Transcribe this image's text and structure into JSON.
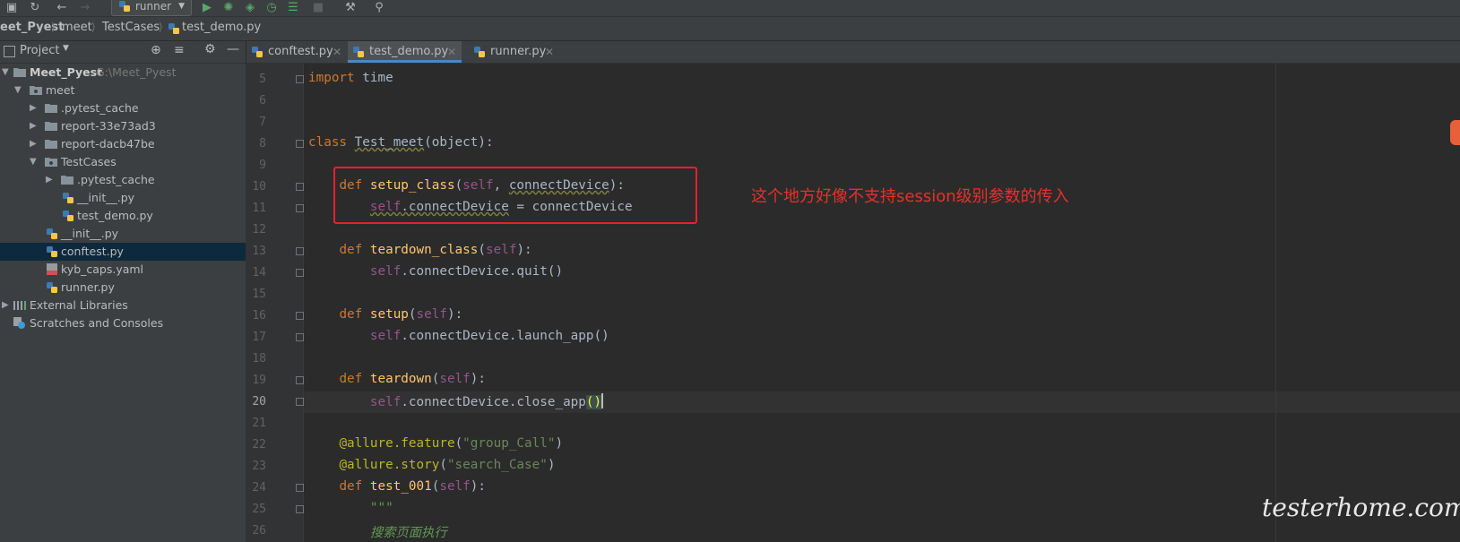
{
  "toolbar": {
    "run_config": "runner",
    "icons": [
      "save-icon",
      "sync-icon",
      "back-arrow-icon",
      "forward-arrow-icon",
      "run-icon",
      "debug-icon",
      "coverage-icon",
      "profile-icon",
      "run-tasks-icon",
      "stop-icon",
      "wrench-icon",
      "search-icon"
    ]
  },
  "breadcrumb": [
    "eet_Pyest",
    "meet",
    "TestCases",
    "test_demo.py"
  ],
  "project_panel": {
    "title": "Project",
    "tree": [
      {
        "label": "Meet_Pyest",
        "path": "G:\\Meet_Pyest"
      },
      {
        "label": "meet"
      },
      {
        "label": ".pytest_cache"
      },
      {
        "label": "report-33e73ad3"
      },
      {
        "label": "report-dacb47be"
      },
      {
        "label": "TestCases"
      },
      {
        "label": ".pytest_cache"
      },
      {
        "label": "__init__.py"
      },
      {
        "label": "test_demo.py"
      },
      {
        "label": "__init__.py"
      },
      {
        "label": "conftest.py"
      },
      {
        "label": "kyb_caps.yaml"
      },
      {
        "label": "runner.py"
      },
      {
        "label": "External Libraries"
      },
      {
        "label": "Scratches and Consoles"
      }
    ]
  },
  "tabs": [
    {
      "label": "conftest.py"
    },
    {
      "label": "test_demo.py"
    },
    {
      "label": "runner.py"
    }
  ],
  "editor": {
    "line_numbers": [
      "5",
      "6",
      "7",
      "8",
      "9",
      "10",
      "11",
      "12",
      "13",
      "14",
      "15",
      "16",
      "17",
      "18",
      "19",
      "20",
      "21",
      "22",
      "23",
      "24",
      "25",
      "26"
    ],
    "lines": {
      "l5": {
        "kw": "import",
        "rest": " time"
      },
      "l8": {
        "kw": "class",
        "name": "Test_meet",
        "base": "(object):"
      },
      "l10": {
        "kw": "def",
        "fn": "setup_class",
        "open": "(",
        "self": "self",
        "args": ", ",
        "param": "connectDevice",
        "close": "):"
      },
      "l11": {
        "self": "self",
        "attr": ".connectDevice",
        "rest": " = connectDevice"
      },
      "l13": {
        "kw": "def",
        "fn": "teardown_class",
        "open": "(",
        "self": "self",
        "close": "):"
      },
      "l14": {
        "self": "self",
        "rest": ".connectDevice.quit()"
      },
      "l16": {
        "kw": "def",
        "fn": "setup",
        "open": "(",
        "self": "self",
        "close": "):"
      },
      "l17": {
        "self": "self",
        "rest": ".connectDevice.launch_app()"
      },
      "l19": {
        "kw": "def",
        "fn": "teardown",
        "open": "(",
        "self": "self",
        "close": "):"
      },
      "l20": {
        "self": "self",
        "rest": ".connectDevice.close_app",
        "paren": "()"
      },
      "l22": {
        "dec": "@allure.feature",
        "open": "(",
        "str": "\"group_Call\"",
        "close": ")"
      },
      "l23": {
        "dec": "@allure.story",
        "open": "(",
        "str": "\"search_Case\"",
        "close": ")"
      },
      "l24": {
        "kw": "def",
        "fn": "test_001",
        "open": "(",
        "self": "self",
        "close": "):"
      },
      "l25": {
        "doc": "\"\"\""
      },
      "l26": {
        "doc": "搜索页面执行"
      }
    }
  },
  "annotation": "这个地方好像不支持session级别参数的传入",
  "watermark": "testerhome.com",
  "colors": {
    "keyword": "#cc7832",
    "function": "#ffc66d",
    "self": "#94558d",
    "string": "#6a8759",
    "decorator": "#bbb529",
    "annotation_red": "#e8202a",
    "selection": "#0d293e",
    "tab_underline": "#4a88c7"
  }
}
